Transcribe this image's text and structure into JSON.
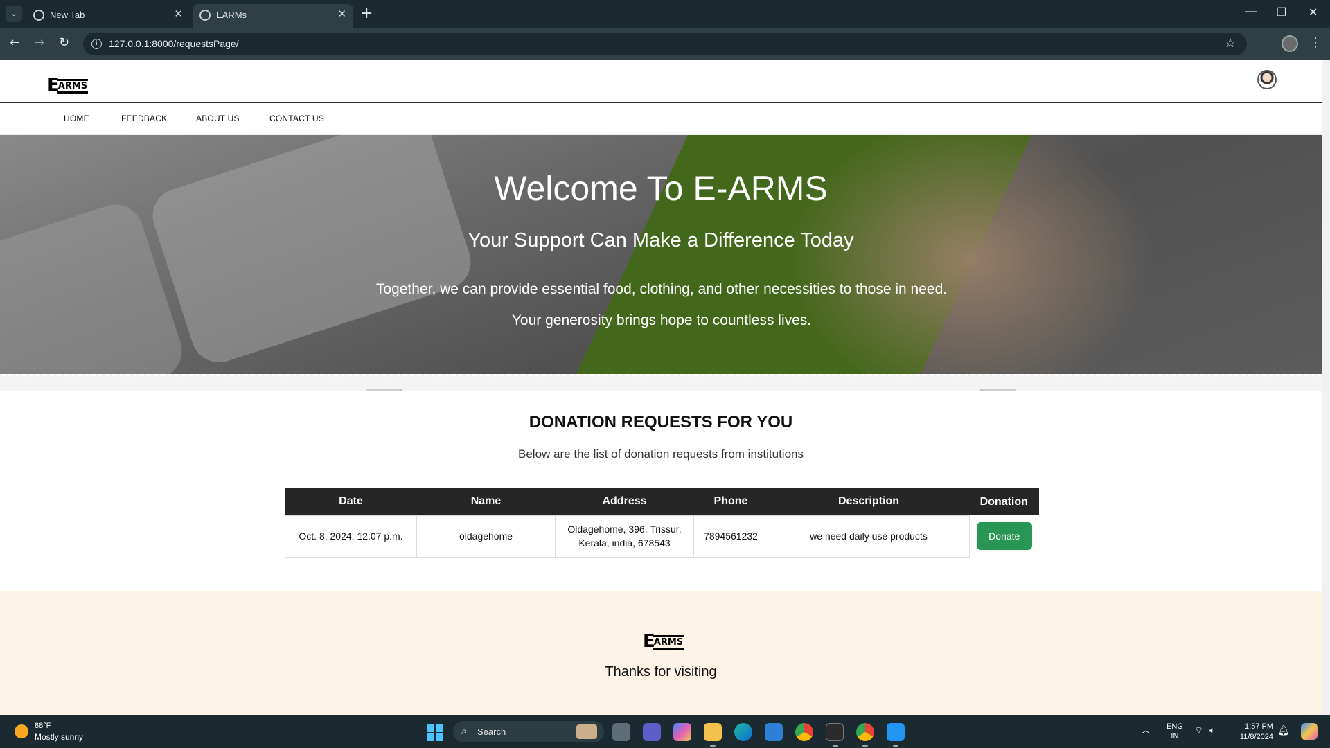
{
  "browser": {
    "tabs": [
      {
        "title": "New Tab",
        "active": false
      },
      {
        "title": "EARMs",
        "active": true
      }
    ],
    "new_tab_symbol": "+",
    "url": "127.0.0.1:8000/requestsPage/",
    "window_controls": {
      "minimize": "—",
      "restore": "❐",
      "close": "✕"
    }
  },
  "site": {
    "logo": {
      "first": "E",
      "rest": "ARMS"
    },
    "nav": [
      {
        "label": "HOME"
      },
      {
        "label": "FEEDBACK"
      },
      {
        "label": "ABOUT US"
      },
      {
        "label": "CONTACT US"
      }
    ],
    "hero": {
      "title": "Welcome To E-ARMS",
      "subtitle": "Your Support Can Make a Difference Today",
      "text": "Together, we can provide essential food, clothing, and other necessities to those in need. Your generosity brings hope to countless lives."
    },
    "section": {
      "title": "DONATION REQUESTS FOR YOU",
      "subtitle": "Below are the list of donation requests from institutions"
    },
    "table": {
      "headers": [
        "Date",
        "Name",
        "Address",
        "Phone",
        "Description",
        "Donation"
      ],
      "rows": [
        {
          "date": "Oct. 8, 2024, 12:07 p.m.",
          "name": "oldagehome",
          "address": "Oldagehome, 396, Trissur, Kerala, india, 678543",
          "phone": "7894561232",
          "description": "we need daily use products",
          "action": "Donate"
        }
      ]
    },
    "footer": {
      "logo": {
        "first": "E",
        "rest": "ARMS"
      },
      "text": "Thanks for visiting"
    },
    "colors": {
      "donate_button": "#2a9656",
      "table_header": "#262626",
      "footer_bg": "#fdf3e6"
    }
  },
  "taskbar": {
    "weather": {
      "temp": "88°F",
      "desc": "Mostly sunny"
    },
    "search_label": "Search",
    "apps": [
      "task-view",
      "teams",
      "copilot",
      "file-explorer",
      "edge",
      "store",
      "chrome",
      "terminal",
      "chrome-profile",
      "vscode"
    ],
    "lang": {
      "line1": "ENG",
      "line2": "IN"
    },
    "clock": {
      "time": "1:57 PM",
      "date": "11/8/2024"
    }
  }
}
